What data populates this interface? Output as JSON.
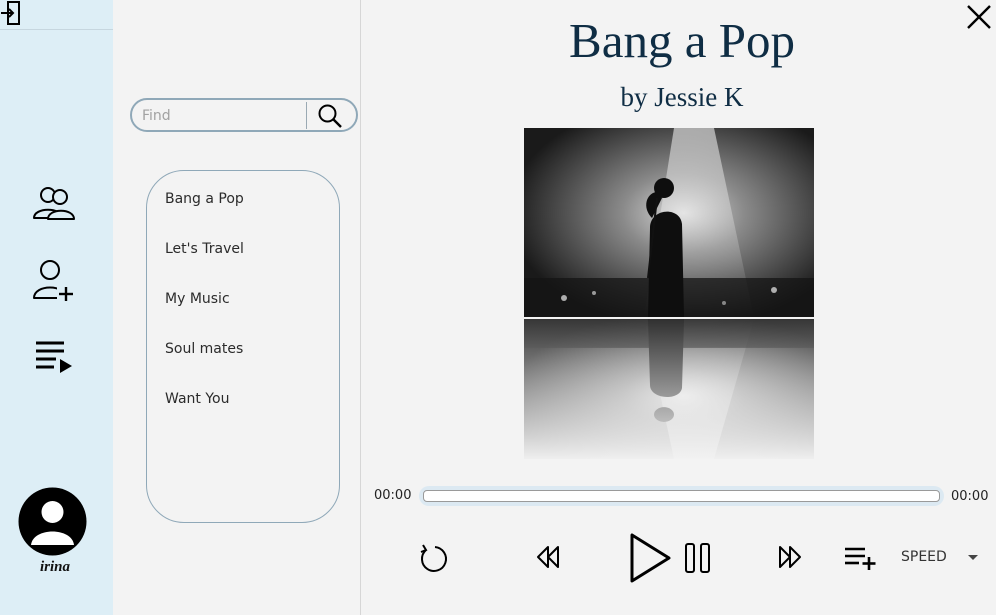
{
  "sidebar": {
    "username": "irina",
    "nav": [
      {
        "icon": "people-icon"
      },
      {
        "icon": "add-user-icon"
      },
      {
        "icon": "playlist-play-icon"
      }
    ]
  },
  "search": {
    "placeholder": "Find",
    "value": ""
  },
  "playlists": [
    {
      "label": "Bang a Pop"
    },
    {
      "label": "Let's Travel"
    },
    {
      "label": "My Music"
    },
    {
      "label": "Soul mates"
    },
    {
      "label": "Want You"
    }
  ],
  "player": {
    "title": "Bang a Pop",
    "artist": "by Jessie K",
    "current_time": "00:00",
    "total_time": "00:00",
    "progress": 0,
    "speed_label": "SPEED"
  },
  "colors": {
    "sidebar_bg": "#ddeef6",
    "title_color": "#0f2d44",
    "panel_border": "#8fa8b8"
  }
}
